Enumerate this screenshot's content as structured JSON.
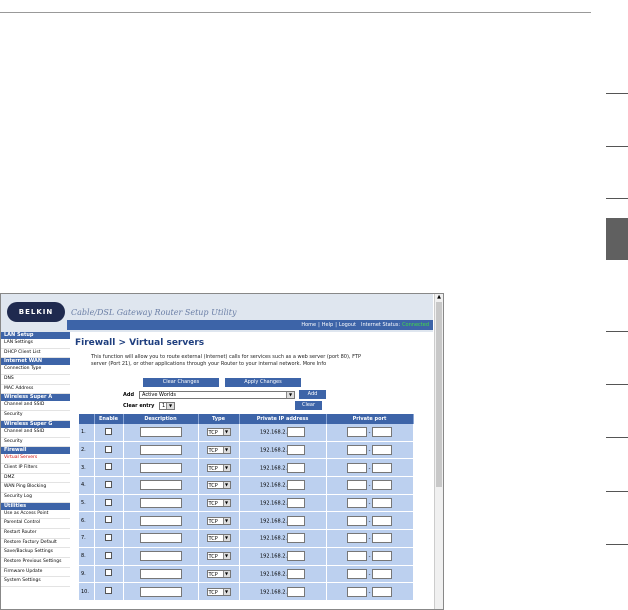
{
  "header": {
    "logo_text": "BELKIN",
    "utility_title": "Cable/DSL Gateway Router Setup Utility",
    "nav_links": [
      "Home",
      "|",
      "Help",
      "|",
      "Logout"
    ],
    "internet_status_label": "Internet Status:",
    "internet_status_value": "Connected"
  },
  "sidebar": {
    "sections": [
      {
        "title": "LAN Setup",
        "items": [
          "LAN Settings",
          "DHCP Client List"
        ]
      },
      {
        "title": "Internet WAN",
        "items": [
          "Connection Type",
          "DNS",
          "MAC Address"
        ]
      },
      {
        "title": "Wireless Super A",
        "items": [
          "Channel and SSID",
          "Security"
        ]
      },
      {
        "title": "Wireless Super G",
        "items": [
          "Channel and SSID",
          "Security"
        ]
      },
      {
        "title": "Firewall",
        "items": [
          "Virtual Servers",
          "Client IP Filters",
          "DMZ",
          "WAN Ping Blocking",
          "Security Log"
        ]
      },
      {
        "title": "Utilities",
        "items": [
          "Use as Access Point",
          "Parental Control",
          "Restart Router",
          "Restore Factory Default",
          "Save/Backup Settings",
          "Restore Previous Settings",
          "Firmware Update",
          "System Settings"
        ]
      }
    ],
    "active_item": "Virtual Servers"
  },
  "main": {
    "title": "Firewall > Virtual servers",
    "description": "This function will allow you to route external (Internet) calls for services such as a web server (port 80), FTP server (Port 21), or other applications through your Router to your internal network.",
    "more_info": "More Info",
    "clear_changes": "Clear Changes",
    "apply_changes": "Apply Changes",
    "add_label": "Add",
    "add_select_value": "Active Worlds",
    "add_button": "Add",
    "clear_entry_label": "Clear entry",
    "clear_entry_value": "1",
    "clear_button": "Clear"
  },
  "table": {
    "headers": [
      "",
      "Enable",
      "Description",
      "Type",
      "Private IP address",
      "Private port"
    ],
    "rows": [
      {
        "num": "1.",
        "type": "TCP",
        "ip_prefix": "192.168.2."
      },
      {
        "num": "2.",
        "type": "TCP",
        "ip_prefix": "192.168.2."
      },
      {
        "num": "3.",
        "type": "TCP",
        "ip_prefix": "192.168.2."
      },
      {
        "num": "4.",
        "type": "TCP",
        "ip_prefix": "192.168.2."
      },
      {
        "num": "5.",
        "type": "TCP",
        "ip_prefix": "192.168.2."
      },
      {
        "num": "6.",
        "type": "TCP",
        "ip_prefix": "192.168.2."
      },
      {
        "num": "7.",
        "type": "TCP",
        "ip_prefix": "192.168.2."
      },
      {
        "num": "8.",
        "type": "TCP",
        "ip_prefix": "192.168.2."
      },
      {
        "num": "9.",
        "type": "TCP",
        "ip_prefix": "192.168.2."
      },
      {
        "num": "10.",
        "type": "TCP",
        "ip_prefix": "192.168.2."
      }
    ],
    "port_separator": "-"
  },
  "colors": {
    "accent": "#3d64a8",
    "row_bg": "#bcd0ef",
    "status": "#44dd44",
    "active": "#cc0000"
  }
}
